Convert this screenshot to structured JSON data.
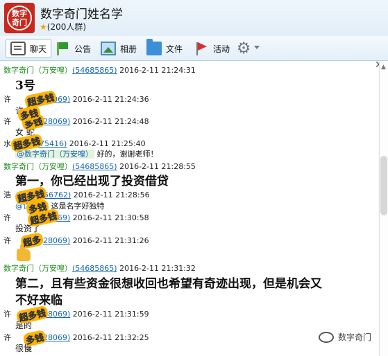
{
  "group": {
    "avatar_text": "数字\n奇门",
    "title": "数字奇门姓名学",
    "members": "(200人群)"
  },
  "toolbar": {
    "tabs": [
      {
        "label": "聊天",
        "icon": "chat-bubble-icon"
      },
      {
        "label": "公告",
        "icon": "flag-notice-icon"
      },
      {
        "label": "相册",
        "icon": "photo-icon"
      },
      {
        "label": "文件",
        "icon": "folder-icon"
      },
      {
        "label": "活动",
        "icon": "red-flag-icon"
      }
    ],
    "settings_icon": "gear-icon"
  },
  "messages": [
    {
      "sender": "数字奇门（万安喤）",
      "qq": "(54685865)",
      "time": "2016-2-11  21:24:31",
      "text": "3号"
    },
    {
      "sender": "许",
      "qq": "28069)",
      "time": "2016-2-11  21:24:36",
      "text": "许  荣"
    },
    {
      "sender": "许",
      "qq": "28069)",
      "time": "2016-2-11  21:24:48",
      "text": "女  蛇"
    },
    {
      "sender": "水",
      "qq": "075416)",
      "time": "2016-2-11  21:25:40",
      "mention": "@数字奇门（万安喤）",
      "text": " 好的，谢谢老师！"
    },
    {
      "sender": "数字奇门（万安喤）",
      "qq": "(54685865)",
      "time": "2016-2-11  21:28:55",
      "text": "第一，你已经出现了投资借贷"
    },
    {
      "sender": "浩",
      "qq": "056762)",
      "time": "2016-2-11  21:28:56",
      "mention": "@许",
      "text": " 这是名字好独特"
    },
    {
      "sender": "许",
      "qq": "28069)",
      "time": "2016-2-11  21:30:58",
      "text": "投资了"
    },
    {
      "sender": "许",
      "qq": "28069)",
      "time": "2016-2-11  21:31:26",
      "text": ""
    },
    {
      "sender": "数字奇门（万安喤）",
      "qq": "(54685865)",
      "time": "2016-2-11  21:31:32",
      "text": "第二，且有些资金很想收回也希望有奇迹出现，但是机会又",
      "text2": "不好来临"
    },
    {
      "sender": "许",
      "qq": "28069)",
      "time": "2016-2-11  21:31:59",
      "text": "是的"
    },
    {
      "sender": "许",
      "qq": "28069)",
      "time": "2016-2-11  21:32:25",
      "text": "很慢"
    }
  ],
  "stamps": [
    "超多钱",
    "多钱",
    "超多钱",
    "超多钱",
    "多钱",
    "超多钱",
    "超多",
    "超多钱",
    "多钱",
    "多钱"
  ],
  "watermark": "数字奇门",
  "colors": {
    "sender_green": "#1a8c1a",
    "qq_blue": "#1566b8",
    "stamp_yellow": "#ffb400"
  }
}
